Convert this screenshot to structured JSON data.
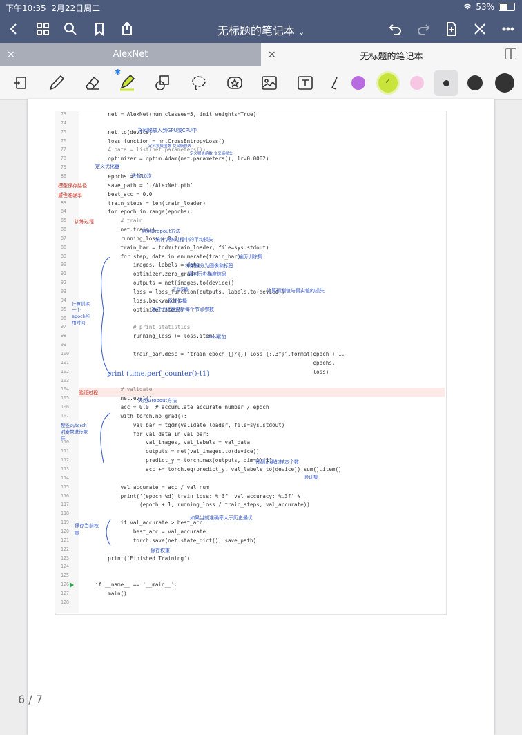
{
  "status": {
    "time": "下午10:35",
    "date": "2月22日周二",
    "wifi_icon": "wifi-icon",
    "battery": "53%"
  },
  "nav": {
    "title": "无标题的笔记本"
  },
  "tabs": [
    {
      "label": "AlexNet",
      "active": false
    },
    {
      "label": "无标题的笔记本",
      "active": true
    }
  ],
  "toolbar": {
    "tools": [
      "lasso-import-icon",
      "pen-icon",
      "eraser-icon",
      "highlighter-icon",
      "shapes-icon",
      "lasso-icon",
      "sticker-icon",
      "image-icon",
      "text-icon",
      "more-tools-icon"
    ],
    "colors": [
      "#b86be0",
      "#c8e43a",
      "#f7c6e2",
      "#333333",
      "#333333",
      "#333333"
    ]
  },
  "page_indicator": "6 / 7",
  "code_lines": [
    {
      "n": "73",
      "t": "    net = AlexNet(num_classes=5, init_weights=True)"
    },
    {
      "n": "74",
      "t": ""
    },
    {
      "n": "75",
      "t": "    net.to(device)"
    },
    {
      "n": "76",
      "t": "    loss_function = nn.CrossEntropyLoss()"
    },
    {
      "n": "77",
      "t": "    # pata = list(net.parameters())"
    },
    {
      "n": "78",
      "t": "    optimizer = optim.Adam(net.parameters(), lr=0.0002)"
    },
    {
      "n": "79",
      "t": ""
    },
    {
      "n": "80",
      "t": "    epochs = 10"
    },
    {
      "n": "81",
      "t": "    save_path = './AlexNet.pth'"
    },
    {
      "n": "82",
      "t": "    best_acc = 0.0"
    },
    {
      "n": "83",
      "t": "    train_steps = len(train_loader)"
    },
    {
      "n": "84",
      "t": "    for epoch in range(epochs):"
    },
    {
      "n": "85",
      "t": "        # train"
    },
    {
      "n": "86",
      "t": "        net.train()"
    },
    {
      "n": "87",
      "t": "        running_loss = 0.0"
    },
    {
      "n": "88",
      "t": "        train_bar = tqdm(train_loader, file=sys.stdout)"
    },
    {
      "n": "89",
      "t": "        for step, data in enumerate(train_bar):"
    },
    {
      "n": "90",
      "t": "            images, labels = data"
    },
    {
      "n": "91",
      "t": "            optimizer.zero_grad()"
    },
    {
      "n": "92",
      "t": "            outputs = net(images.to(device))"
    },
    {
      "n": "93",
      "t": "            loss = loss_function(outputs, labels.to(device))"
    },
    {
      "n": "94",
      "t": "            loss.backward()"
    },
    {
      "n": "95",
      "t": "            optimizer.step()"
    },
    {
      "n": "96",
      "t": ""
    },
    {
      "n": "97",
      "t": "            # print statistics"
    },
    {
      "n": "98",
      "t": "            running_loss += loss.item()"
    },
    {
      "n": "99",
      "t": ""
    },
    {
      "n": "100",
      "t": "            train_bar.desc = \"train epoch[{}/{}] loss:{:.3f}\".format(epoch + 1,"
    },
    {
      "n": "101",
      "t": "                                                                     epochs,"
    },
    {
      "n": "102",
      "t": "                                                                     loss)"
    },
    {
      "n": "103",
      "t": ""
    },
    {
      "n": "104",
      "t": "        # validate"
    },
    {
      "n": "105",
      "t": "        net.eval()"
    },
    {
      "n": "106",
      "t": "        acc = 0.0  # accumulate accurate number / epoch"
    },
    {
      "n": "107",
      "t": "        with torch.no_grad():"
    },
    {
      "n": "108",
      "t": "            val_bar = tqdm(validate_loader, file=sys.stdout)"
    },
    {
      "n": "109",
      "t": "            for val_data in val_bar:"
    },
    {
      "n": "110",
      "t": "                val_images, val_labels = val_data"
    },
    {
      "n": "111",
      "t": "                outputs = net(val_images.to(device))"
    },
    {
      "n": "112",
      "t": "                predict_y = torch.max(outputs, dim=1)[1]"
    },
    {
      "n": "113",
      "t": "                acc += torch.eq(predict_y, val_labels.to(device)).sum().item()"
    },
    {
      "n": "114",
      "t": ""
    },
    {
      "n": "115",
      "t": "        val_accurate = acc / val_num"
    },
    {
      "n": "116",
      "t": "        print('[epoch %d] train_loss: %.3f  val_accuracy: %.3f' %"
    },
    {
      "n": "117",
      "t": "              (epoch + 1, running_loss / train_steps, val_accurate))"
    },
    {
      "n": "118",
      "t": ""
    },
    {
      "n": "119",
      "t": "        if val_accurate > best_acc:"
    },
    {
      "n": "120",
      "t": "            best_acc = val_accurate"
    },
    {
      "n": "121",
      "t": "            torch.save(net.state_dict(), save_path)"
    },
    {
      "n": "122",
      "t": ""
    },
    {
      "n": "123",
      "t": "    print('Finished Training')"
    },
    {
      "n": "124",
      "t": ""
    },
    {
      "n": "125",
      "t": ""
    },
    {
      "n": "126",
      "t": "if __name__ == '__main__':"
    },
    {
      "n": "127",
      "t": "    main()"
    },
    {
      "n": "128",
      "t": ""
    }
  ],
  "annotations": {
    "a75": "将网络放入到GPU或CPU中",
    "a76": "定义损失函数 交叉熵损失",
    "a78": "定义优化器",
    "a80": "迭代10次",
    "a81": "模型保存路径",
    "a82": "最佳准确率",
    "a85": "训练过程",
    "a86": "启用Dropout方法",
    "a87": "统计训练过程中的平均损失",
    "a89": "遍历训练集",
    "a90": "将数据分为图像和标签",
    "a91": "清空历史梯度信息",
    "a92": "正向传播",
    "a93": "计算预测值与真实值的损失",
    "a94": "反向传播",
    "a95": "通过优化器更新每个节点参数",
    "a98": "loss累加",
    "a102": "print (time.perf_counter()-t1)",
    "a104": "验证过程",
    "a105": "关闭Dropout方法",
    "a108": "验证集",
    "a113": "预测正确的样本个数",
    "a119": "如果当前准确率大于历史最优",
    "a121": "保存权重",
    "left_train": "计算训练一个epoch所用时间",
    "left_val": "禁止pytorch对参数进行跟踪",
    "left_save": "保存当前权重"
  }
}
